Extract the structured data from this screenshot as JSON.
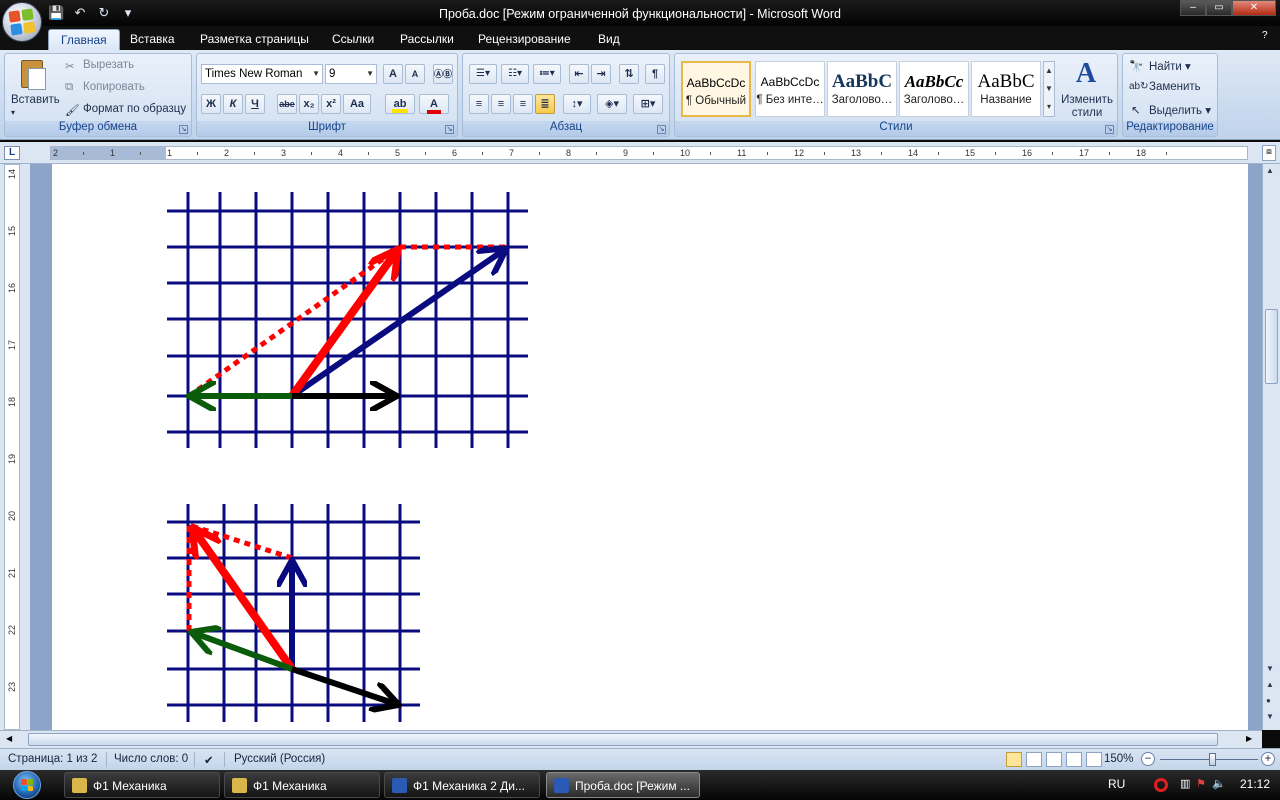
{
  "window": {
    "title": "Проба.doc [Режим ограниченной функциональности] - Microsoft Word",
    "controls": {
      "minimize": "‒",
      "maximize": "▭",
      "close": "✕"
    }
  },
  "qat": {
    "save_icon": "💾",
    "undo_icon": "↶",
    "redo_icon": "↻",
    "more": "▾"
  },
  "ribbon_tabs": [
    "Главная",
    "Вставка",
    "Разметка страницы",
    "Ссылки",
    "Рассылки",
    "Рецензирование",
    "Вид"
  ],
  "active_tab": "Главная",
  "clipboard": {
    "paste": "Вставить",
    "cut": "Вырезать",
    "copy": "Копировать",
    "format_painter": "Формат по образцу",
    "group": "Буфер обмена"
  },
  "font": {
    "name": "Times New Roman",
    "size": "9",
    "group": "Шрифт",
    "buttons": [
      "Ж",
      "К",
      "Ч",
      "abe",
      "x₂",
      "x²",
      "Aa"
    ],
    "grow": "A",
    "shrink": "A"
  },
  "paragraph": {
    "group": "Абзац",
    "pilcrow": "¶"
  },
  "styles": {
    "group": "Стили",
    "items": [
      {
        "sample": "AaBbCcDc",
        "name": "¶ Обычный"
      },
      {
        "sample": "AaBbCcDc",
        "name": "¶ Без инте…"
      },
      {
        "sample": "AaBbC",
        "name": "Заголово…"
      },
      {
        "sample": "AaBbCc",
        "name": "Заголово…"
      },
      {
        "sample": "AaBbC",
        "name": "Название"
      }
    ],
    "change": "Изменить стили"
  },
  "editing": {
    "group": "Редактирование",
    "find": "Найти",
    "replace": "Заменить",
    "select": "Выделить"
  },
  "ruler": {
    "corner": "L",
    "labels": [
      "2",
      "1",
      "1",
      "2",
      "3",
      "4",
      "5",
      "6",
      "7",
      "8",
      "9",
      "10",
      "11",
      "12",
      "13",
      "14",
      "15",
      "16",
      "17",
      "18"
    ],
    "vlabels": [
      "14",
      "15",
      "16",
      "17",
      "18",
      "19",
      "20",
      "21",
      "22",
      "23"
    ]
  },
  "status": {
    "page": "Страница: 1 из 2",
    "words": "Число слов: 0",
    "language": "Русский (Россия)",
    "zoom": "150%",
    "zoom_minus": "−",
    "zoom_plus": "+"
  },
  "taskbar": {
    "items": [
      {
        "label": "Ф1 Механика",
        "color": "#d9b54a"
      },
      {
        "label": "Ф1 Механика",
        "color": "#d9b54a"
      },
      {
        "label": "Ф1 Механика 2 Ди...",
        "color": "#2b5ab4"
      },
      {
        "label": "Проба.doc [Режим ...",
        "color": "#2b5ab4"
      }
    ],
    "lang": "RU",
    "time": "21:12"
  },
  "colors": {
    "grid": "#0b0b80",
    "red": "#ff0000",
    "blue": "#0b0b80",
    "green": "#0a5c0a",
    "black": "#000000"
  }
}
